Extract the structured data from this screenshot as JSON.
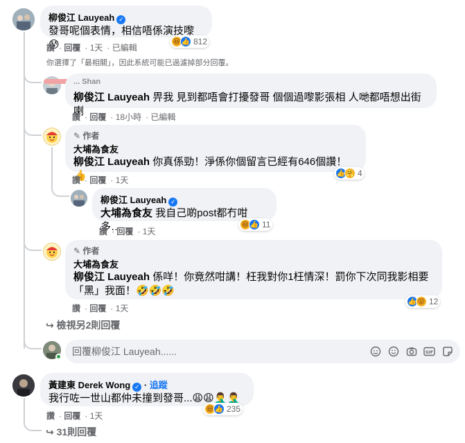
{
  "comments": {
    "c1": {
      "name": "柳俊江 Lauyeah",
      "text": "發哥呢個表情，相信唔係演技嚟😰",
      "reaction_count": "812",
      "actions": {
        "like": "讚",
        "reply": "回覆",
        "time": "1天",
        "edited": "已編輯"
      }
    },
    "notice": "你選擇了「最相關」，因此系統可能已過濾掉部分回覆。",
    "r1": {
      "name_partial": "... Shan",
      "tag": "柳俊江 Lauyeah",
      "text": "畀我 見到都唔會打擾發哥 個個過嚟影張相 人哋都唔想出街喇",
      "actions": {
        "like": "讚",
        "reply": "回覆",
        "time": "18小時",
        "edited": "已編輯"
      }
    },
    "r2": {
      "author_tag": "作者",
      "name": "大埔為食友",
      "tag": "柳俊江 Lauyeah",
      "text": "你真係勁！淨係你個留言已經有646個讚！👍",
      "reaction_count": "4",
      "actions": {
        "like": "讚",
        "reply": "回覆",
        "time": "1天"
      }
    },
    "r3": {
      "name": "柳俊江 Lauyeah",
      "tag": "大埔為食友",
      "text": "我自己啲post都冇咁多…",
      "reaction_count": "11",
      "actions": {
        "like": "讚",
        "reply": "回覆",
        "time": "1天"
      }
    },
    "r4": {
      "author_tag": "作者",
      "name": "大埔為食友",
      "tag": "柳俊江 Lauyeah",
      "text_line1": "係咩！你竟然咁講！枉我對你1枉情深！罰你下次同我影相要",
      "text_line2": "「黑」我面！🤣🤣🤣",
      "reaction_count": "12",
      "actions": {
        "like": "讚",
        "reply": "回覆",
        "time": "1天"
      }
    },
    "view_more_replies": "檢視另2則回覆",
    "reply_placeholder": "回覆柳俊江 Lauyeah......",
    "c2": {
      "name": "黃建東 Derek Wong",
      "follow": "追蹤",
      "text": "我行咗一世山都仲未撞到發哥...😩😩🤦‍♂️🤦‍♂️",
      "reaction_count": "235",
      "actions": {
        "like": "讚",
        "reply": "回覆",
        "time": "1天"
      }
    },
    "view_more_c2": "31則回覆"
  },
  "icons": {
    "reply_arrow": "reply-arrow-icon",
    "verified": "verified-badge-icon",
    "pencil": "pencil-icon",
    "sticker": "sticker-icon",
    "emoji": "emoji-icon",
    "camera": "camera-icon",
    "gif": "gif-icon",
    "avatar_sticker": "avatar-sticker-icon"
  },
  "colors": {
    "bubble": "#f0f2f5",
    "meta": "#65676b",
    "like_blue": "#1877f2",
    "haha_yellow": "#f7b125"
  }
}
